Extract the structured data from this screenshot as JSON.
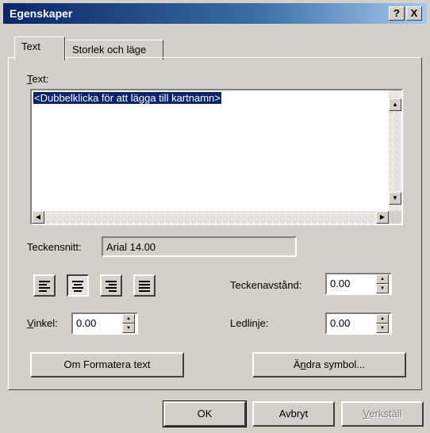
{
  "window": {
    "title": "Egenskaper",
    "help_label": "?",
    "close_label": "X"
  },
  "tabs": [
    {
      "label": "Text",
      "active": true
    },
    {
      "label": "Storlek och läge",
      "active": false
    }
  ],
  "text_section": {
    "label_rest": "ext:",
    "label_mnemonic": "T",
    "content": "<Dubbelklicka för att lägga till kartnamn>"
  },
  "font": {
    "label": "Teckensnitt:",
    "value": "Arial 14.00"
  },
  "alignment": {
    "options": [
      "align-left",
      "align-center",
      "align-right",
      "align-justify"
    ],
    "selected": "align-center"
  },
  "char_spacing": {
    "label": "Teckenavstånd:",
    "value": "0.00"
  },
  "angle": {
    "label_mnemonic": "V",
    "label_rest": "inkel:",
    "value": "0.00"
  },
  "leader": {
    "label": "Ledlinje:",
    "value": "0.00"
  },
  "buttons": {
    "format_text": "Om Formatera text",
    "change_symbol_pre": "Ä",
    "change_symbol_mnemonic": "n",
    "change_symbol_post": "dra symbol...",
    "ok": "OK",
    "cancel": "Avbryt",
    "apply_mnemonic": "V",
    "apply_rest": "erkställ"
  },
  "colors": {
    "title_bar": "#0a246a",
    "face": "#d4d0c8",
    "selection": "#0a246a"
  }
}
